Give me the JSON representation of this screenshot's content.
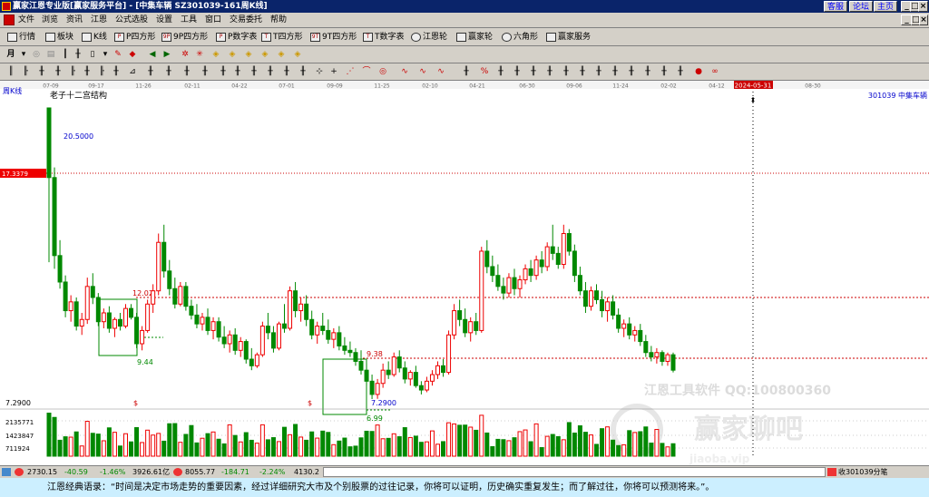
{
  "window": {
    "title": "赢家江恩专业版[赢家服务平台] - [中集车辆  SZ301039-161周K线]",
    "links": [
      "客服",
      "论坛",
      "主页"
    ],
    "controls": [
      "_",
      "□",
      "×"
    ]
  },
  "menu": [
    "文件",
    "浏览",
    "资讯",
    "江恩",
    "公式选股",
    "设置",
    "工具",
    "窗口",
    "交易委托",
    "帮助"
  ],
  "menu_controls": [
    "_",
    "□",
    "×"
  ],
  "toolbar1": [
    {
      "icon": "grid-icon",
      "label": "行情"
    },
    {
      "icon": "block-icon",
      "label": "板块"
    },
    {
      "icon": "kline-icon",
      "label": "K线"
    },
    {
      "icon": "p-icon",
      "label": "P四方形"
    },
    {
      "icon": "9p-icon",
      "label": "9P四方形"
    },
    {
      "icon": "p-icon",
      "label": "P数字表"
    },
    {
      "icon": "t-icon",
      "label": "T四方形"
    },
    {
      "icon": "9t-icon",
      "label": "9T四方形"
    },
    {
      "icon": "t-icon",
      "label": "T数字表"
    },
    {
      "icon": "circle-icon",
      "label": "江恩轮"
    },
    {
      "icon": "wheel-icon",
      "label": "赢家轮"
    },
    {
      "icon": "hexagon-icon",
      "label": "六角形"
    },
    {
      "icon": "service-icon",
      "label": "赢家服务"
    }
  ],
  "toolbar2_first": "月",
  "chart": {
    "period_label": "周K线",
    "study_name": "老子十二宫结构",
    "stock_label": "301039  中集车辆",
    "price_tag": "17.3379",
    "top_price_label": "20.5000",
    "volume_labels": [
      "2135771",
      "1423847",
      "711924"
    ],
    "low_price_label": "7.2900",
    "watermark": "江恩工具软件  QQ:100800360",
    "watermark_logo": "赢家聊吧",
    "watermark_url": "jiaoba.vip",
    "cursor_date": "2024-05-31",
    "dollar_mark": "$",
    "annotations": [
      {
        "text": "12.02",
        "color": "#cc0000"
      },
      {
        "text": "9.44",
        "color": "#008000"
      },
      {
        "text": "9.38",
        "color": "#cc0000"
      },
      {
        "text": "7.2900",
        "color": "#0000cc"
      },
      {
        "text": "6.99",
        "color": "#008000"
      }
    ]
  },
  "chart_data": {
    "type": "candlestick",
    "title": "",
    "period": "weekly",
    "x_tick_labels": [
      "07-09",
      "09-17",
      "11-26",
      "02-11",
      "04-22",
      "07-01",
      "09-09",
      "11-25",
      "02-10",
      "04-21",
      "06-30",
      "09-06",
      "11-24",
      "02-02",
      "04-12",
      "2024-05-31",
      "08-30"
    ],
    "y_reference_lines": [
      12.02,
      9.38,
      17.3379
    ],
    "price_range": [
      6.5,
      21
    ],
    "candles": [
      [
        20.5,
        20.5,
        13.5,
        17.34
      ],
      [
        17.34,
        17.8,
        13.2,
        13.8
      ],
      [
        13.8,
        14.5,
        12.3,
        12.6
      ],
      [
        12.6,
        12.9,
        11.0,
        11.3
      ],
      [
        11.3,
        12.0,
        10.8,
        11.7
      ],
      [
        11.7,
        11.9,
        10.4,
        10.6
      ],
      [
        10.6,
        11.2,
        10.2,
        10.9
      ],
      [
        10.9,
        12.8,
        10.7,
        12.4
      ],
      [
        12.4,
        13.0,
        11.6,
        11.9
      ],
      [
        11.9,
        12.1,
        10.6,
        10.8
      ],
      [
        10.8,
        11.4,
        10.5,
        11.2
      ],
      [
        11.2,
        11.5,
        10.3,
        10.5
      ],
      [
        10.5,
        11.0,
        10.1,
        10.9
      ],
      [
        10.9,
        11.2,
        10.4,
        10.6
      ],
      [
        10.6,
        11.6,
        10.5,
        11.4
      ],
      [
        11.4,
        11.6,
        10.9,
        11.0
      ],
      [
        11.0,
        11.2,
        9.6,
        9.8
      ],
      [
        9.8,
        10.6,
        9.5,
        10.4
      ],
      [
        10.4,
        11.8,
        10.3,
        11.6
      ],
      [
        11.6,
        12.5,
        11.2,
        12.2
      ],
      [
        12.2,
        14.8,
        12.0,
        14.4
      ],
      [
        14.4,
        15.2,
        12.8,
        13.1
      ],
      [
        13.1,
        13.6,
        12.0,
        12.3
      ],
      [
        12.3,
        12.8,
        11.4,
        11.6
      ],
      [
        11.6,
        12.6,
        11.5,
        12.4
      ],
      [
        12.4,
        12.6,
        11.3,
        11.5
      ],
      [
        11.5,
        11.8,
        10.9,
        11.1
      ],
      [
        11.1,
        11.6,
        10.5,
        10.7
      ],
      [
        10.7,
        11.2,
        10.4,
        11.0
      ],
      [
        11.0,
        11.4,
        10.2,
        10.4
      ],
      [
        10.4,
        11.0,
        10.0,
        10.8
      ],
      [
        10.8,
        11.0,
        9.9,
        10.1
      ],
      [
        10.1,
        10.6,
        9.6,
        9.8
      ],
      [
        9.8,
        10.4,
        9.4,
        10.2
      ],
      [
        10.2,
        10.5,
        9.3,
        9.5
      ],
      [
        9.5,
        10.1,
        9.2,
        9.9
      ],
      [
        9.9,
        10.0,
        8.9,
        9.1
      ],
      [
        9.1,
        9.6,
        8.6,
        8.8
      ],
      [
        8.8,
        9.4,
        8.7,
        9.3
      ],
      [
        9.3,
        10.8,
        9.2,
        10.6
      ],
      [
        10.6,
        11.2,
        10.0,
        10.3
      ],
      [
        10.3,
        10.6,
        9.4,
        9.6
      ],
      [
        9.6,
        10.8,
        9.5,
        10.7
      ],
      [
        10.7,
        11.6,
        10.3,
        10.5
      ],
      [
        10.5,
        12.4,
        10.4,
        12.2
      ],
      [
        12.2,
        12.6,
        11.0,
        11.3
      ],
      [
        11.3,
        11.9,
        10.8,
        11.6
      ],
      [
        11.6,
        12.0,
        10.6,
        10.9
      ],
      [
        10.9,
        11.3,
        10.0,
        10.2
      ],
      [
        10.2,
        10.8,
        9.8,
        10.6
      ],
      [
        10.6,
        11.2,
        10.2,
        10.4
      ],
      [
        10.4,
        10.9,
        9.8,
        10.0
      ],
      [
        10.0,
        10.5,
        9.6,
        10.3
      ],
      [
        10.3,
        10.6,
        9.5,
        9.7
      ],
      [
        9.7,
        10.1,
        9.3,
        9.5
      ],
      [
        9.5,
        9.9,
        9.2,
        9.4
      ],
      [
        9.4,
        9.6,
        8.8,
        9.0
      ],
      [
        9.0,
        9.5,
        8.4,
        8.6
      ],
      [
        8.6,
        8.9,
        7.9,
        8.1
      ],
      [
        8.1,
        8.4,
        7.29,
        7.5
      ],
      [
        7.5,
        8.2,
        7.3,
        8.0
      ],
      [
        8.0,
        8.9,
        7.8,
        8.6
      ],
      [
        8.6,
        9.0,
        8.2,
        8.4
      ],
      [
        8.4,
        9.4,
        8.3,
        9.2
      ],
      [
        9.2,
        9.5,
        8.5,
        8.7
      ],
      [
        8.7,
        9.0,
        8.0,
        8.2
      ],
      [
        8.2,
        8.6,
        7.9,
        8.5
      ],
      [
        8.5,
        8.8,
        7.8,
        7.9
      ],
      [
        7.9,
        8.1,
        7.5,
        7.7
      ],
      [
        7.7,
        8.3,
        7.6,
        8.1
      ],
      [
        8.1,
        8.6,
        7.9,
        8.4
      ],
      [
        8.4,
        9.0,
        8.2,
        8.8
      ],
      [
        8.8,
        9.1,
        8.3,
        8.5
      ],
      [
        8.5,
        10.4,
        8.4,
        10.2
      ],
      [
        10.2,
        11.6,
        10.0,
        11.3
      ],
      [
        11.3,
        11.8,
        10.6,
        10.9
      ],
      [
        10.9,
        11.4,
        10.1,
        10.3
      ],
      [
        10.3,
        11.0,
        9.9,
        10.8
      ],
      [
        10.8,
        11.2,
        10.2,
        10.4
      ],
      [
        10.4,
        14.2,
        10.3,
        14.0
      ],
      [
        14.0,
        14.5,
        13.0,
        13.3
      ],
      [
        13.3,
        13.8,
        12.6,
        12.9
      ],
      [
        12.9,
        13.4,
        12.2,
        12.4
      ],
      [
        12.4,
        12.8,
        11.8,
        12.1
      ],
      [
        12.1,
        13.0,
        11.9,
        12.8
      ],
      [
        12.8,
        13.2,
        12.0,
        12.3
      ],
      [
        12.3,
        12.9,
        11.9,
        12.7
      ],
      [
        12.7,
        13.4,
        12.5,
        13.2
      ],
      [
        13.2,
        13.6,
        12.6,
        12.9
      ],
      [
        12.9,
        13.8,
        12.7,
        13.6
      ],
      [
        13.6,
        14.0,
        13.0,
        13.3
      ],
      [
        13.3,
        14.4,
        13.1,
        14.2
      ],
      [
        14.2,
        15.2,
        13.6,
        13.9
      ],
      [
        13.9,
        14.2,
        13.2,
        13.4
      ],
      [
        13.4,
        15.2,
        13.2,
        14.8
      ],
      [
        14.8,
        15.0,
        13.8,
        14.0
      ],
      [
        14.0,
        14.3,
        12.6,
        12.9
      ],
      [
        12.9,
        13.3,
        12.0,
        12.2
      ],
      [
        12.2,
        12.6,
        11.2,
        11.5
      ],
      [
        11.5,
        12.4,
        11.3,
        12.2
      ],
      [
        12.2,
        12.5,
        11.6,
        11.8
      ],
      [
        11.8,
        12.2,
        11.0,
        11.3
      ],
      [
        11.3,
        11.9,
        10.8,
        11.7
      ],
      [
        11.7,
        12.0,
        10.9,
        11.1
      ],
      [
        11.1,
        11.4,
        10.3,
        10.5
      ],
      [
        10.5,
        10.9,
        10.1,
        10.7
      ],
      [
        10.7,
        11.0,
        10.0,
        10.2
      ],
      [
        10.2,
        10.6,
        9.9,
        10.4
      ],
      [
        10.4,
        10.7,
        9.7,
        9.9
      ],
      [
        9.9,
        10.2,
        9.2,
        9.4
      ],
      [
        9.4,
        9.7,
        9.0,
        9.2
      ],
      [
        9.2,
        9.6,
        8.9,
        9.4
      ],
      [
        9.4,
        9.5,
        8.8,
        9.0
      ],
      [
        9.0,
        9.4,
        8.8,
        9.3
      ],
      [
        9.3,
        9.4,
        8.5,
        8.6
      ]
    ]
  },
  "status": {
    "index1_value": "2730.15",
    "index1_change": "-40.59",
    "index1_pct": "-1.46%",
    "index1_volume": "3926.61亿",
    "index2_value": "8055.77",
    "index2_change": "-184.71",
    "index2_pct": "-2.24%",
    "index2_volume": "4130.2",
    "right_text": "收301039分笔"
  },
  "quote": "江恩经典语录：“时间是决定市场走势的重要因素，经过详细研究大市及个别股票的过往记录，你将可以证明，历史确实重复发生；而了解过往，你将可以预测将来。”。"
}
